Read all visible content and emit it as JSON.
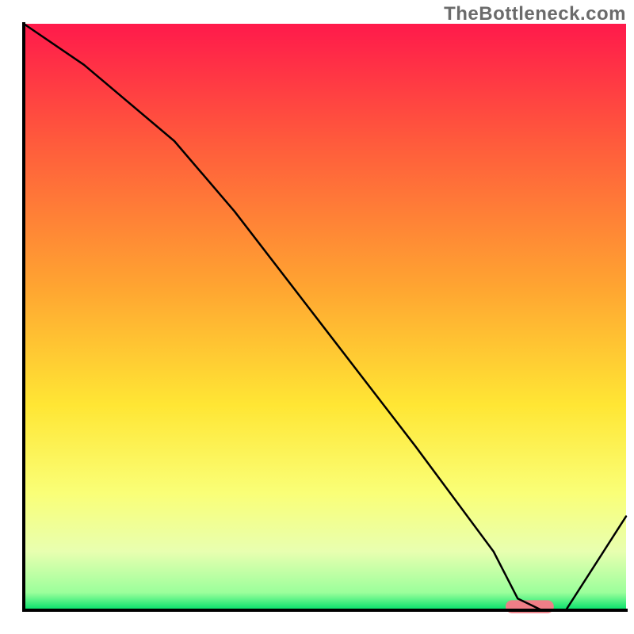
{
  "watermark": "TheBottleneck.com",
  "chart_data": {
    "type": "line",
    "title": "",
    "xlabel": "",
    "ylabel": "",
    "xlim": [
      0,
      100
    ],
    "ylim": [
      0,
      100
    ],
    "grid": false,
    "legend": false,
    "background_gradient": {
      "stops": [
        {
          "offset": 0.0,
          "color": "#ff1a4b"
        },
        {
          "offset": 0.2,
          "color": "#ff5a3c"
        },
        {
          "offset": 0.45,
          "color": "#ffa531"
        },
        {
          "offset": 0.65,
          "color": "#ffe634"
        },
        {
          "offset": 0.8,
          "color": "#faff77"
        },
        {
          "offset": 0.9,
          "color": "#e8ffb0"
        },
        {
          "offset": 0.97,
          "color": "#9bff9b"
        },
        {
          "offset": 1.0,
          "color": "#00e06a"
        }
      ]
    },
    "series": [
      {
        "name": "bottleneck-curve",
        "color": "#000000",
        "stroke_width": 2.5,
        "x": [
          0,
          10,
          25,
          35,
          50,
          65,
          78,
          82,
          86,
          90,
          100
        ],
        "y": [
          100,
          93,
          80,
          68,
          48,
          28,
          10,
          2,
          0,
          0,
          16
        ]
      }
    ],
    "marker": {
      "name": "optimal-range-marker",
      "shape": "rounded-bar",
      "color": "#ef7e87",
      "x_start": 80,
      "x_end": 88,
      "y": 0.6,
      "height": 2.2
    },
    "axes": {
      "left": {
        "visible": true,
        "color": "#000000",
        "width": 4
      },
      "bottom": {
        "visible": true,
        "color": "#000000",
        "width": 4
      },
      "top": {
        "visible": false
      },
      "right": {
        "visible": false
      }
    }
  }
}
